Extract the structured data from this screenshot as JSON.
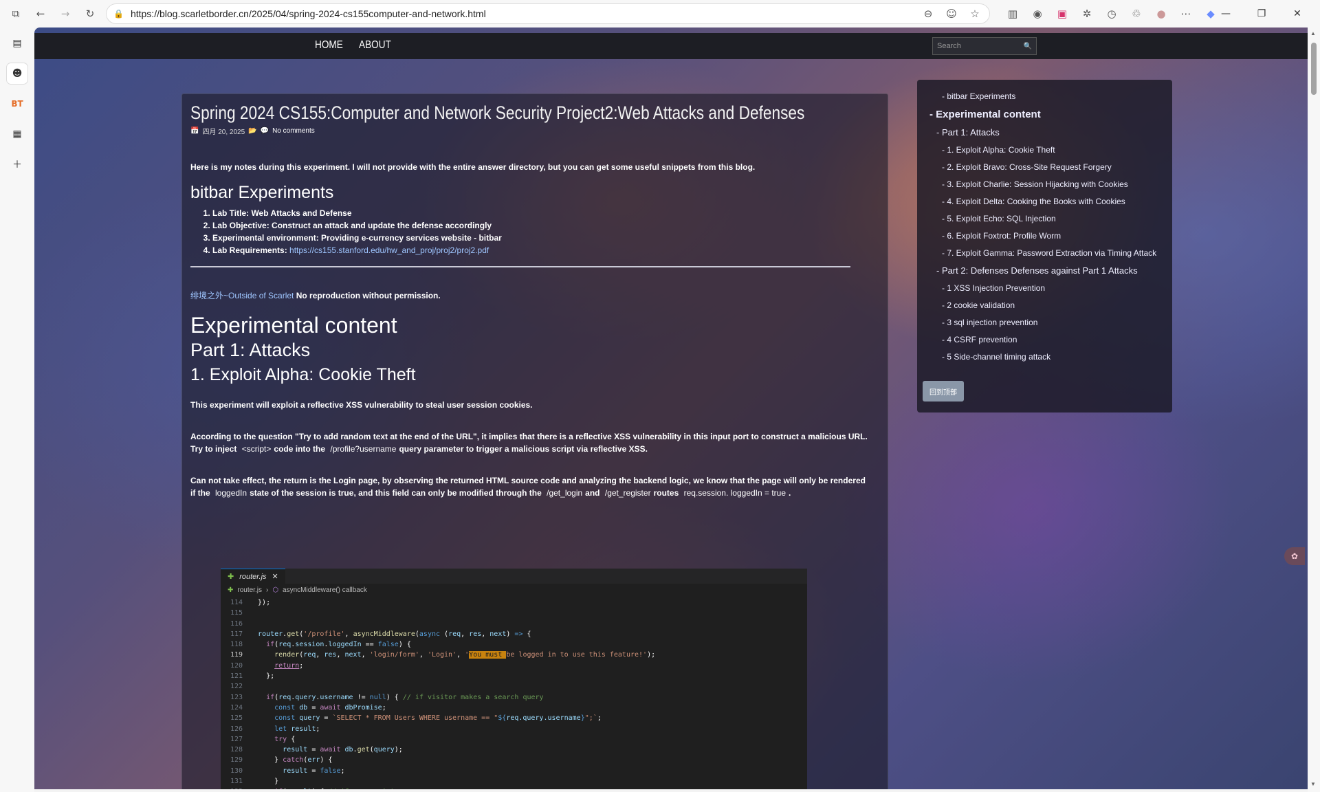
{
  "browser": {
    "url": "https://blog.scarletborder.cn/2025/04/spring-2024-cs155computer-and-network.html"
  },
  "blog": {
    "nav": {
      "home": "HOME",
      "about": "ABOUT",
      "search_placeholder": "Search"
    },
    "post": {
      "title": "Spring 2024 CS155:Computer and Network Security Project2:Web Attacks and Defenses",
      "date": "四月 20, 2025",
      "comments": "No comments",
      "intro": "Here is my notes during this experiment. I will not provide with the entire answer directory, but you can get some useful snippets from this blog.",
      "bitbar_heading": "bitbar Experiments",
      "lab_items": [
        "Lab Title: Web Attacks and Defense",
        "Lab Objective: Construct an attack and update the defense accordingly",
        "Experimental environment: Providing e-currency services website - bitbar"
      ],
      "lab_req_label": "Lab Requirements: ",
      "lab_req_link": "https://cs155.stanford.edu/hw_and_proj/proj2/proj2.pdf",
      "copyright_link": "绯境之外~Outside of Scarlet",
      "copyright_text": " No reproduction without permission.",
      "h_experimental": "Experimental content",
      "h_part1": "Part 1: Attacks",
      "h_exploit1": "1. Exploit Alpha: Cookie Theft",
      "p1": "This experiment will exploit a reflective XSS vulnerability to steal user session cookies.",
      "p2_a": "According to the question \"Try to add random text at the end of the URL\", it implies that there is a reflective XSS vulnerability in this input port to construct a malicious URL. Try to inject",
      "p2_code1": "<script>",
      "p2_b": "code into the",
      "p2_code2": "/profile?username",
      "p2_c": "query parameter to trigger a malicious script via reflective XSS.",
      "p3_a": "Can not take effect, the return is the Login page, by observing the returned HTML source code and analyzing the backend logic, we know that the page will only be rendered if the",
      "p3_code1": "loggedIn",
      "p3_b": "state of the session is true, and this field can only be modified through the",
      "p3_code2": "/get_login",
      "p3_c": "and",
      "p3_code3": "/get_register",
      "p3_d": "routes",
      "p3_code4": "req.session. loggedIn = true",
      "p3_e": "."
    },
    "code_image": {
      "tab": "router.js",
      "crumb_file": "router.js",
      "crumb_fn": "asyncMiddleware() callback"
    },
    "toc": {
      "items": [
        {
          "label": "- bitbar Experiments",
          "level": 3
        },
        {
          "label": "- Experimental content",
          "level": 1
        },
        {
          "label": "- Part 1: Attacks",
          "level": 2
        },
        {
          "label": "- 1. Exploit Alpha: Cookie Theft",
          "level": 3
        },
        {
          "label": "- 2. Exploit Bravo: Cross-Site Request Forgery",
          "level": 3
        },
        {
          "label": "- 3. Exploit Charlie: Session Hijacking with Cookies",
          "level": 3
        },
        {
          "label": "- 4. Exploit Delta: Cooking the Books with Cookies",
          "level": 3
        },
        {
          "label": "- 5. Exploit Echo: SQL Injection",
          "level": 3
        },
        {
          "label": "- 6. Exploit Foxtrot: Profile Worm",
          "level": 3
        },
        {
          "label": "- 7. Exploit Gamma: Password Extraction via Timing Attack",
          "level": 3
        },
        {
          "label": "- Part 2: Defenses Defenses against Part 1 Attacks",
          "level": 2
        },
        {
          "label": "- 1 XSS Injection Prevention",
          "level": 3
        },
        {
          "label": "- 2 cookie validation",
          "level": 3
        },
        {
          "label": "- 3 sql injection prevention",
          "level": 3
        },
        {
          "label": "- 4 CSRF prevention",
          "level": 3
        },
        {
          "label": "- 5 Side-channel timing attack",
          "level": 3
        }
      ],
      "back_to_top": "回到顶部"
    }
  }
}
